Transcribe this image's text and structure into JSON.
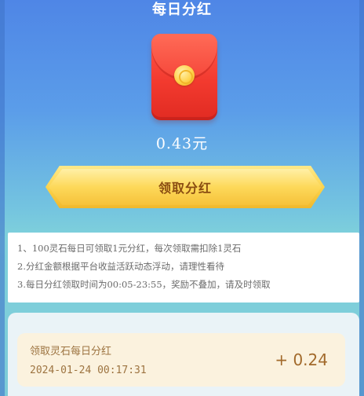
{
  "header": {
    "title": "每日分红"
  },
  "envelope": {
    "icon": "red-envelope-icon",
    "color": "#f23a2f"
  },
  "balance": {
    "amount_text": "0.43元"
  },
  "claim_button": {
    "label": "领取分红",
    "color": "#fbd24a"
  },
  "rules": [
    "1、100灵石每日可领取1元分红，每次领取需扣除1灵石",
    "2.分红金额根据平台收益活跃动态浮动，请理性看待",
    "3.每日分红领取时间为00:05-23:55，奖励不叠加，请及时领取"
  ],
  "history": {
    "records": [
      {
        "name": "领取灵石每日分红",
        "time": "2024-01-24 00:17:31",
        "amount": "+ 0.24"
      }
    ]
  }
}
